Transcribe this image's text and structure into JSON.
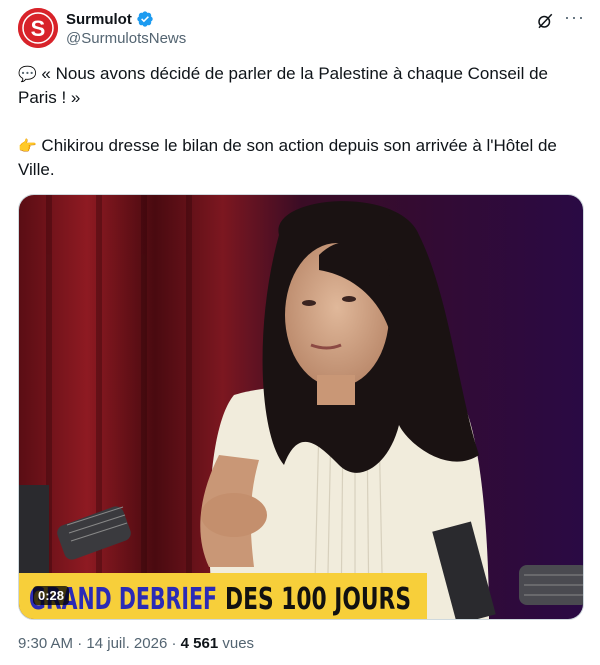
{
  "author": {
    "display_name": "Surmulot",
    "handle": "@SurmulotsNews",
    "avatar_letter": "S",
    "brand_color": "#d8232a",
    "verified_color": "#1d9bf0"
  },
  "tweet": {
    "line1_emoji": "💬",
    "line1_text": "« Nous avons décidé de parler de la Palestine à chaque Conseil de Paris ! »",
    "line2_emoji": "👉",
    "line2_text": "Chikirou dresse le bilan de son action depuis son arrivée à l'Hôtel de Ville."
  },
  "media": {
    "banner_left": "GRAND DEBRIEF",
    "banner_right": "DES 100 JOURS",
    "duration": "0:28",
    "banner_color": "#f7cf3a",
    "banner_text_color": "#2b2bb5"
  },
  "meta": {
    "time": "9:30 AM",
    "separator1": " · ",
    "date": "14 juil. 2026",
    "separator2": " · ",
    "views_count": "4 561",
    "views_label": " vues"
  },
  "icons": [
    "verified-badge-icon",
    "grok-icon",
    "more-icon",
    "speech-bubble-icon",
    "pointing-hand-icon"
  ]
}
